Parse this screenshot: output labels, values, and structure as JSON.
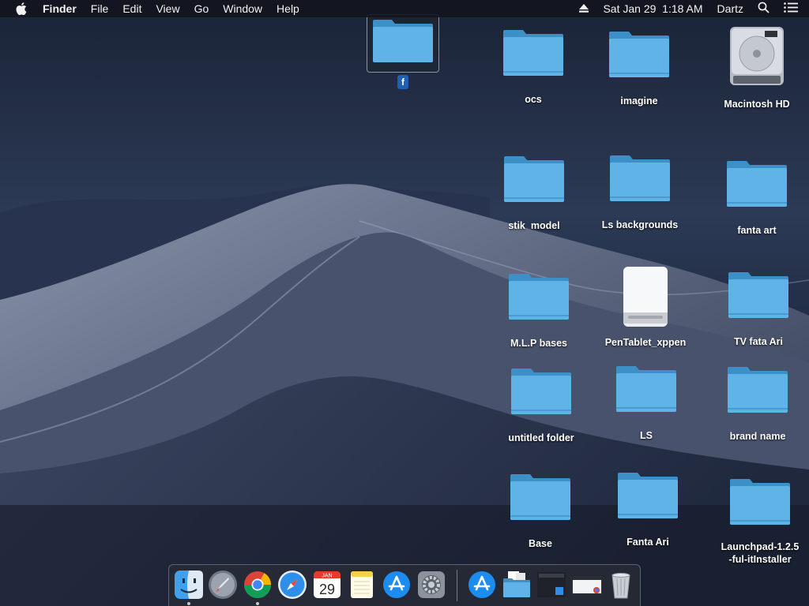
{
  "menubar": {
    "app_name": "Finder",
    "menus": [
      "File",
      "Edit",
      "View",
      "Go",
      "Window",
      "Help"
    ],
    "datetime": "Sat Jan 29  1:18 AM",
    "user": "Dartz"
  },
  "desktop": {
    "selected_icon": {
      "label": "f"
    },
    "icons": [
      {
        "label": "ocs",
        "type": "folder"
      },
      {
        "label": "imagine",
        "type": "folder"
      },
      {
        "label": "Macintosh HD",
        "type": "hard-drive"
      },
      {
        "label": "stik  model",
        "type": "folder"
      },
      {
        "label": "Ls backgrounds",
        "type": "folder"
      },
      {
        "label": "fanta art",
        "type": "folder"
      },
      {
        "label": "M.L.P bases",
        "type": "folder"
      },
      {
        "label": "PenTablet_xppen",
        "type": "external-drive"
      },
      {
        "label": "TV fata Ari",
        "type": "folder"
      },
      {
        "label": "untitled folder",
        "type": "folder"
      },
      {
        "label": "LS",
        "type": "folder"
      },
      {
        "label": "brand name",
        "type": "folder"
      },
      {
        "label": "Base",
        "type": "folder"
      },
      {
        "label": "Fanta Ari",
        "type": "folder"
      },
      {
        "label": "Launchpad-1.2.5\n-ful-itInstaller",
        "type": "folder"
      }
    ]
  },
  "dock": {
    "items": [
      {
        "name": "finder-icon",
        "running": true
      },
      {
        "name": "launchpad-icon",
        "running": false
      },
      {
        "name": "chrome-icon",
        "running": true
      },
      {
        "name": "safari-icon",
        "running": false
      },
      {
        "name": "calendar-icon",
        "running": false,
        "month": "JAN",
        "day": "29"
      },
      {
        "name": "notes-icon",
        "running": false
      },
      {
        "name": "app-store-icon",
        "running": false
      },
      {
        "name": "system-preferences-icon",
        "running": false
      },
      {
        "name": "downloads-app-store-icon",
        "running": false
      },
      {
        "name": "documents-folder-icon",
        "running": false
      },
      {
        "name": "screenshot-stack-icon",
        "running": false
      },
      {
        "name": "window-thumbnail-icon",
        "running": false
      },
      {
        "name": "trash-icon",
        "running": false
      }
    ]
  },
  "colors": {
    "folder": "#5fb3e6",
    "folder_dark": "#3d8fc7",
    "selection": "#1f5fb4"
  }
}
